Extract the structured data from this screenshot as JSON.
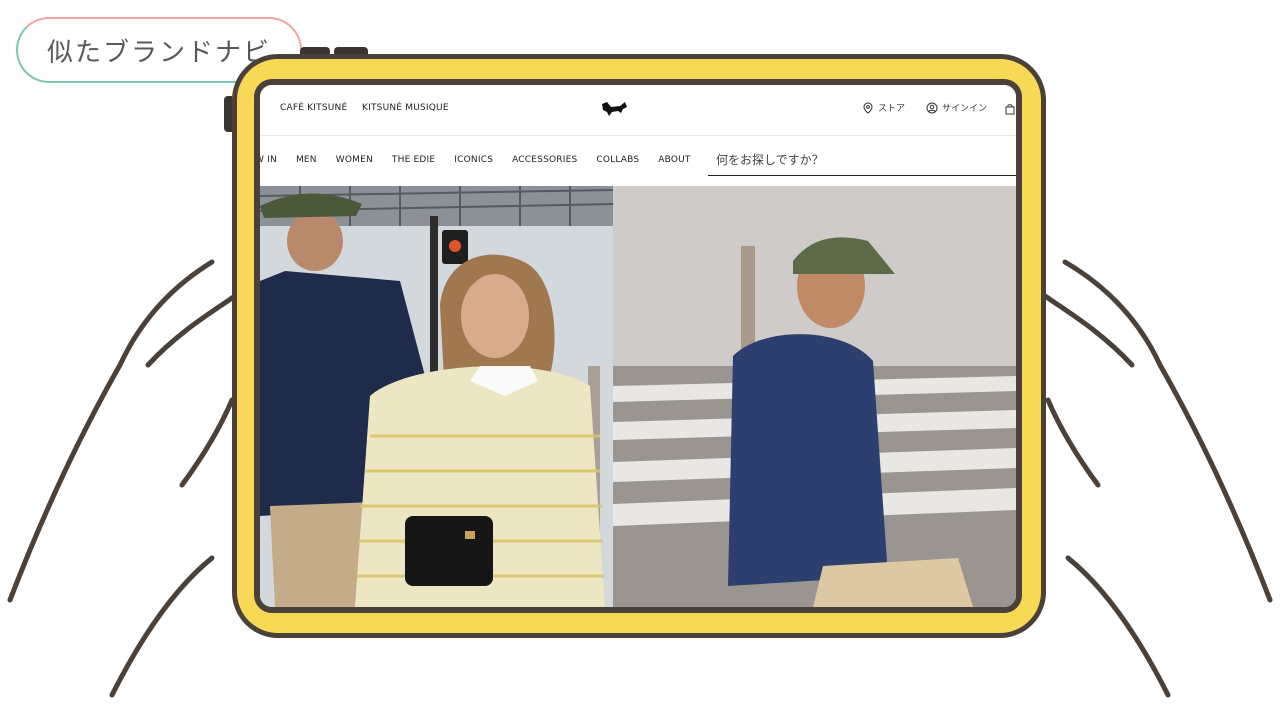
{
  "badge": {
    "text": "似たブランドナビ"
  },
  "topbar": {
    "links": [
      "CAFÉ KITSUNÉ",
      "KITSUNÉ MUSIQUE"
    ],
    "logo_icon": "fox-logo-icon",
    "store_label": "ストア",
    "signin_label": "サインイン",
    "icons": [
      "location-pin-icon",
      "user-icon",
      "shopping-bag-icon"
    ]
  },
  "nav": {
    "items": [
      "W IN",
      "MEN",
      "WOMEN",
      "THE EDIE",
      "ICONICS",
      "ACCESSORIES",
      "COLLABS",
      "ABOUT"
    ],
    "search_placeholder": "何をお探しですか？"
  },
  "colors": {
    "tablet_frame": "#f7d956",
    "tablet_outline": "#4a413b",
    "badge_border_pink": "#f0a6a6",
    "badge_border_green": "#7fc6b1",
    "hand_stroke": "#4a413b"
  }
}
